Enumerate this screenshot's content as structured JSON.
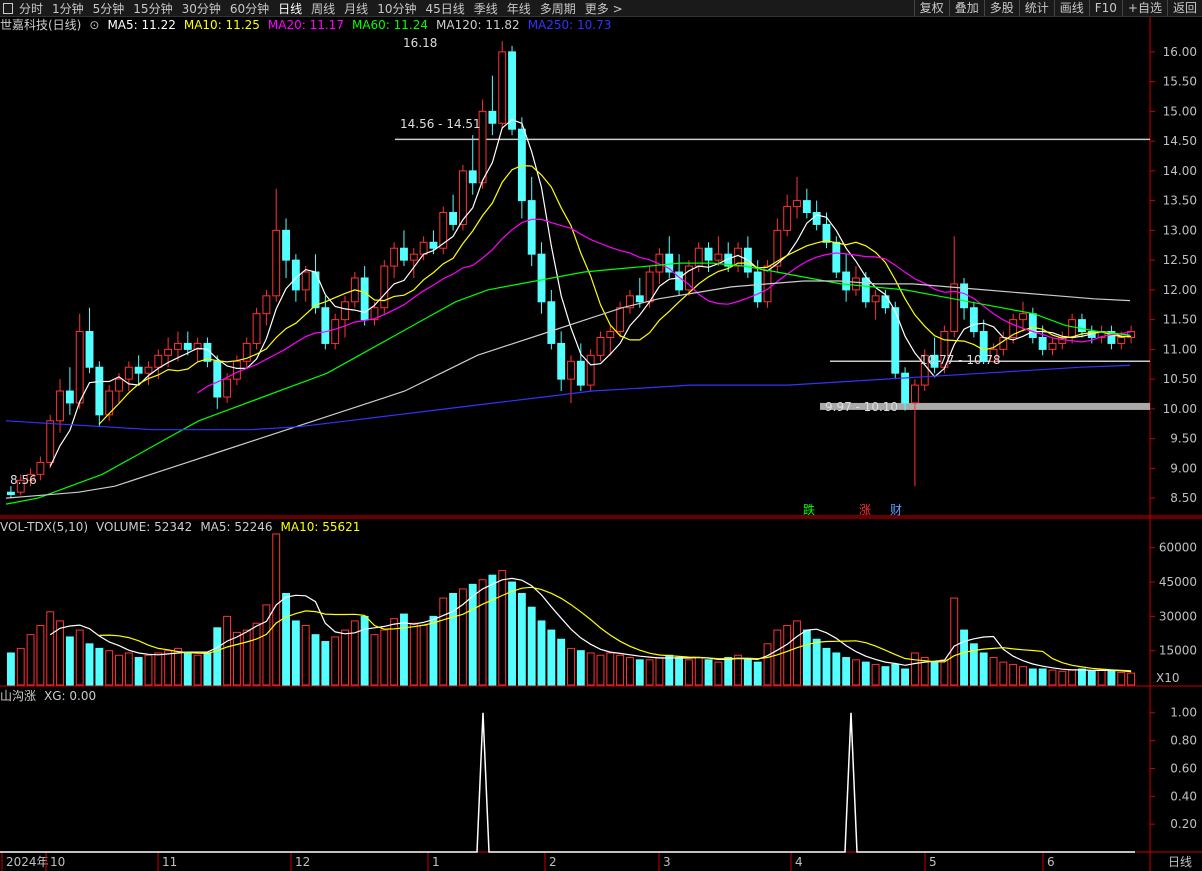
{
  "toolbar": {
    "menu_icon": "window-icon",
    "tabs": [
      "分时",
      "1分钟",
      "5分钟",
      "15分钟",
      "30分钟",
      "60分钟",
      "日线",
      "周线",
      "月线",
      "10分钟",
      "45日线",
      "季线",
      "年线",
      "多周期",
      "更多 >"
    ],
    "active_tab": "日线",
    "right_buttons": [
      "复权",
      "叠加",
      "多股",
      "统计",
      "画线",
      "F10",
      "+自选",
      "返回"
    ]
  },
  "main_legend": {
    "title": "世嘉科技(日线)",
    "items": [
      {
        "text": "MA5: 11.22",
        "color": "#ffffff"
      },
      {
        "text": "MA10: 11.25",
        "color": "#ffff00"
      },
      {
        "text": "MA20: 11.17",
        "color": "#ff00ff"
      },
      {
        "text": "MA60: 11.24",
        "color": "#00ff00"
      },
      {
        "text": "MA120: 11.82",
        "color": "#cccccc"
      },
      {
        "text": "MA250: 10.73",
        "color": "#3333ff"
      }
    ]
  },
  "vol_legend": {
    "items": [
      {
        "text": "VOL-TDX(5,10)",
        "color": "#cccccc"
      },
      {
        "text": "VOLUME: 52342",
        "color": "#cccccc"
      },
      {
        "text": "MA5: 52246",
        "color": "#cccccc"
      },
      {
        "text": "MA10: 55621",
        "color": "#ffff00"
      }
    ]
  },
  "ind_legend": {
    "items": [
      {
        "text": "山沟涨",
        "color": "#cccccc"
      },
      {
        "text": "XG: 0.00",
        "color": "#cccccc"
      }
    ]
  },
  "colors": {
    "up": "#ff3232",
    "down": "#54ffff",
    "axis": "#cc0000",
    "grid": "#3a0000"
  },
  "chart_data": [
    {
      "type": "candlestick",
      "title": "世嘉科技(日线)",
      "ylim": [
        8.2,
        16.3
      ],
      "y_ticks": [
        8.5,
        9.0,
        9.5,
        10.0,
        10.5,
        11.0,
        11.5,
        12.0,
        12.5,
        13.0,
        13.5,
        14.0,
        14.5,
        15.0,
        15.5,
        16.0
      ],
      "y_tick_labels": [
        "8.50",
        "9.00",
        "9.50",
        "10.00",
        "10.50",
        "11.00",
        "11.50",
        "12.00",
        "12.50",
        "13.00",
        "13.50",
        "14.00",
        "14.50",
        "15.00",
        "15.50",
        "16.00"
      ],
      "x_labels": [
        "2024年",
        "10",
        "11",
        "12",
        "1",
        "2",
        "3",
        "4",
        "5",
        "6"
      ],
      "ohlc": [
        [
          8.6,
          8.7,
          8.5,
          8.56
        ],
        [
          8.6,
          8.9,
          8.55,
          8.8
        ],
        [
          8.8,
          9.0,
          8.7,
          8.9
        ],
        [
          8.9,
          9.2,
          8.8,
          9.1
        ],
        [
          9.1,
          9.9,
          9.0,
          9.8
        ],
        [
          9.8,
          10.5,
          9.6,
          10.3
        ],
        [
          10.3,
          10.7,
          9.9,
          10.1
        ],
        [
          10.1,
          11.6,
          10.0,
          11.3
        ],
        [
          11.3,
          11.7,
          10.6,
          10.7
        ],
        [
          10.7,
          10.8,
          9.7,
          9.9
        ],
        [
          9.9,
          10.4,
          9.8,
          10.3
        ],
        [
          10.3,
          10.6,
          10.1,
          10.5
        ],
        [
          10.5,
          10.8,
          10.3,
          10.7
        ],
        [
          10.7,
          10.9,
          10.4,
          10.6
        ],
        [
          10.6,
          10.8,
          10.4,
          10.7
        ],
        [
          10.7,
          11.0,
          10.5,
          10.9
        ],
        [
          10.9,
          11.2,
          10.7,
          11.0
        ],
        [
          11.0,
          11.3,
          10.8,
          11.1
        ],
        [
          11.1,
          11.3,
          10.9,
          11.0
        ],
        [
          11.0,
          11.2,
          10.8,
          11.1
        ],
        [
          11.1,
          11.2,
          10.7,
          10.8
        ],
        [
          10.8,
          10.9,
          10.0,
          10.2
        ],
        [
          10.2,
          10.6,
          10.1,
          10.5
        ],
        [
          10.5,
          10.9,
          10.4,
          10.8
        ],
        [
          10.8,
          11.2,
          10.7,
          11.1
        ],
        [
          11.1,
          11.7,
          11.0,
          11.6
        ],
        [
          11.6,
          12.0,
          11.4,
          11.9
        ],
        [
          11.9,
          13.7,
          11.8,
          13.0
        ],
        [
          13.0,
          13.2,
          12.2,
          12.5
        ],
        [
          12.5,
          12.6,
          11.8,
          12.0
        ],
        [
          12.0,
          12.4,
          11.8,
          12.3
        ],
        [
          12.3,
          12.6,
          11.6,
          11.7
        ],
        [
          11.7,
          11.9,
          11.0,
          11.1
        ],
        [
          11.1,
          11.6,
          11.0,
          11.5
        ],
        [
          11.5,
          11.9,
          11.2,
          11.8
        ],
        [
          11.8,
          12.3,
          11.7,
          12.2
        ],
        [
          12.2,
          12.4,
          11.4,
          11.5
        ],
        [
          11.5,
          11.8,
          11.4,
          11.7
        ],
        [
          11.7,
          12.5,
          11.6,
          12.4
        ],
        [
          12.4,
          12.8,
          12.2,
          12.7
        ],
        [
          12.7,
          13.0,
          12.4,
          12.5
        ],
        [
          12.5,
          12.7,
          12.2,
          12.6
        ],
        [
          12.6,
          12.9,
          12.5,
          12.8
        ],
        [
          12.8,
          13.0,
          12.6,
          12.7
        ],
        [
          12.7,
          13.4,
          12.6,
          13.3
        ],
        [
          13.3,
          13.6,
          13.0,
          13.1
        ],
        [
          13.1,
          14.1,
          13.0,
          14.0
        ],
        [
          14.0,
          14.6,
          13.6,
          13.8
        ],
        [
          13.8,
          15.2,
          13.7,
          15.0
        ],
        [
          15.0,
          15.6,
          14.6,
          14.8
        ],
        [
          14.8,
          16.18,
          14.7,
          16.0
        ],
        [
          16.0,
          16.1,
          14.6,
          14.7
        ],
        [
          14.7,
          14.9,
          13.2,
          13.5
        ],
        [
          13.5,
          13.9,
          12.4,
          12.6
        ],
        [
          12.6,
          12.8,
          11.6,
          11.8
        ],
        [
          11.8,
          12.0,
          11.0,
          11.1
        ],
        [
          11.1,
          11.3,
          10.3,
          10.5
        ],
        [
          10.5,
          10.9,
          10.1,
          10.8
        ],
        [
          10.8,
          11.1,
          10.3,
          10.4
        ],
        [
          10.4,
          11.0,
          10.3,
          10.9
        ],
        [
          10.9,
          11.3,
          10.8,
          11.2
        ],
        [
          11.2,
          11.4,
          10.9,
          11.3
        ],
        [
          11.3,
          11.8,
          11.2,
          11.7
        ],
        [
          11.7,
          12.0,
          11.6,
          11.9
        ],
        [
          11.9,
          12.2,
          11.7,
          11.8
        ],
        [
          11.8,
          12.4,
          11.7,
          12.3
        ],
        [
          12.3,
          12.7,
          12.1,
          12.6
        ],
        [
          12.6,
          12.9,
          12.2,
          12.3
        ],
        [
          12.3,
          12.6,
          11.9,
          12.0
        ],
        [
          12.0,
          12.5,
          11.9,
          12.4
        ],
        [
          12.4,
          12.8,
          12.3,
          12.7
        ],
        [
          12.7,
          12.8,
          12.3,
          12.5
        ],
        [
          12.5,
          12.9,
          12.4,
          12.6
        ],
        [
          12.6,
          12.8,
          12.3,
          12.4
        ],
        [
          12.4,
          12.8,
          12.3,
          12.7
        ],
        [
          12.7,
          12.9,
          12.2,
          12.3
        ],
        [
          12.3,
          12.5,
          11.7,
          11.8
        ],
        [
          11.8,
          12.5,
          11.7,
          12.4
        ],
        [
          12.4,
          13.2,
          12.3,
          13.0
        ],
        [
          13.0,
          13.6,
          12.9,
          13.4
        ],
        [
          13.4,
          13.9,
          13.2,
          13.5
        ],
        [
          13.5,
          13.7,
          13.2,
          13.3
        ],
        [
          13.3,
          13.5,
          13.0,
          13.1
        ],
        [
          13.1,
          13.3,
          12.7,
          12.8
        ],
        [
          12.8,
          12.9,
          12.2,
          12.3
        ],
        [
          12.3,
          12.6,
          11.8,
          12.0
        ],
        [
          12.0,
          12.4,
          11.9,
          12.2
        ],
        [
          12.2,
          12.3,
          11.7,
          11.8
        ],
        [
          11.8,
          12.0,
          11.5,
          11.9
        ],
        [
          11.9,
          12.0,
          11.6,
          11.7
        ],
        [
          11.7,
          11.8,
          10.5,
          10.6
        ],
        [
          10.6,
          10.7,
          9.97,
          10.1
        ],
        [
          10.1,
          10.5,
          8.7,
          10.4
        ],
        [
          10.4,
          11.0,
          10.3,
          10.9
        ],
        [
          10.9,
          11.2,
          10.6,
          10.7
        ],
        [
          10.7,
          11.4,
          10.6,
          11.3
        ],
        [
          11.3,
          12.9,
          11.2,
          12.1
        ],
        [
          12.1,
          12.2,
          11.5,
          11.7
        ],
        [
          11.7,
          11.8,
          11.2,
          11.3
        ],
        [
          11.3,
          11.5,
          10.77,
          10.8
        ],
        [
          10.8,
          11.1,
          10.78,
          11.0
        ],
        [
          11.0,
          11.3,
          10.9,
          11.2
        ],
        [
          11.2,
          11.6,
          11.1,
          11.5
        ],
        [
          11.5,
          11.8,
          11.3,
          11.6
        ],
        [
          11.6,
          11.7,
          11.1,
          11.2
        ],
        [
          11.2,
          11.4,
          10.9,
          11.0
        ],
        [
          11.0,
          11.2,
          10.9,
          11.1
        ],
        [
          11.1,
          11.3,
          11.0,
          11.2
        ],
        [
          11.2,
          11.6,
          11.1,
          11.5
        ],
        [
          11.5,
          11.6,
          11.2,
          11.3
        ],
        [
          11.3,
          11.4,
          11.1,
          11.2
        ],
        [
          11.2,
          11.4,
          11.1,
          11.3
        ],
        [
          11.3,
          11.4,
          11.0,
          11.1
        ],
        [
          11.1,
          11.3,
          11.0,
          11.2
        ],
        [
          11.2,
          11.4,
          11.1,
          11.3
        ]
      ],
      "annotations": [
        "16.18",
        "14.56 - 14.51",
        "8.56",
        "10.77 - 10.78",
        "9.97 - 10.10"
      ],
      "markers": [
        {
          "text": "跌",
          "color": "#00ff00"
        },
        {
          "text": "涨",
          "color": "#ff3232"
        },
        {
          "text": "财",
          "color": "#5aa0ff"
        }
      ],
      "hlines": [
        {
          "y": 14.53,
          "color": "#cccccc"
        },
        {
          "y": 10.8,
          "color": "#cccccc"
        },
        {
          "y": 10.05,
          "color": "#aaaaaa",
          "band": true
        }
      ],
      "series": [
        {
          "name": "MA60",
          "color": "#00ff00",
          "values": [
            8.4,
            8.5,
            8.7,
            8.9,
            9.2,
            9.5,
            9.8,
            10.0,
            10.2,
            10.4,
            10.6,
            10.9,
            11.2,
            11.5,
            11.8,
            12.0,
            12.1,
            12.2,
            12.3,
            12.35,
            12.4,
            12.45,
            12.45,
            12.4,
            12.3,
            12.2,
            12.1,
            12.05,
            12.0,
            11.9,
            11.8,
            11.7,
            11.6,
            11.4,
            11.3,
            11.24
          ]
        },
        {
          "name": "MA120",
          "color": "#cccccc",
          "values": [
            8.5,
            8.55,
            8.6,
            8.7,
            8.9,
            9.1,
            9.3,
            9.5,
            9.7,
            9.9,
            10.1,
            10.3,
            10.6,
            10.9,
            11.1,
            11.3,
            11.5,
            11.7,
            11.85,
            11.95,
            12.05,
            12.1,
            12.15,
            12.15,
            12.1,
            12.1,
            12.05,
            12.0,
            11.95,
            11.9,
            11.85,
            11.82
          ]
        },
        {
          "name": "MA250",
          "color": "#3333ff",
          "values": [
            9.8,
            9.75,
            9.7,
            9.65,
            9.65,
            9.65,
            9.7,
            9.8,
            9.9,
            10.0,
            10.1,
            10.2,
            10.3,
            10.35,
            10.4,
            10.4,
            10.4,
            10.45,
            10.5,
            10.55,
            10.6,
            10.65,
            10.7,
            10.73
          ]
        }
      ]
    },
    {
      "type": "bar",
      "title": "VOL-TDX(5,10)",
      "ylim": [
        0,
        66000
      ],
      "y_ticks": [
        15000,
        30000,
        45000,
        60000
      ],
      "y_tick_labels": [
        "15000",
        "30000",
        "45000",
        "60000"
      ],
      "unit_label": "X10",
      "values": [
        14000,
        16000,
        22000,
        26000,
        32000,
        28000,
        21000,
        24000,
        18000,
        16000,
        15000,
        13000,
        14000,
        12000,
        13000,
        14000,
        15000,
        16000,
        14000,
        13000,
        14000,
        25000,
        30000,
        23000,
        24000,
        27000,
        35000,
        66000,
        40000,
        28000,
        26000,
        22000,
        19000,
        21000,
        24000,
        28000,
        30000,
        22000,
        24000,
        29000,
        31000,
        27000,
        26000,
        30000,
        38000,
        40000,
        42000,
        44000,
        46000,
        48000,
        50000,
        45000,
        40000,
        34000,
        28000,
        24000,
        20000,
        16000,
        15000,
        14000,
        13000,
        14000,
        13000,
        12000,
        11000,
        11000,
        12000,
        13000,
        12000,
        11000,
        12000,
        11000,
        10000,
        12000,
        13000,
        11000,
        10000,
        18000,
        24000,
        26000,
        28000,
        24000,
        20000,
        16000,
        14000,
        12000,
        11000,
        10000,
        9000,
        8000,
        9000,
        7000,
        14000,
        12000,
        10000,
        11000,
        38000,
        24000,
        18000,
        14000,
        12000,
        10000,
        9000,
        8000,
        7000,
        7000,
        6500,
        6000,
        6500,
        7000,
        6000,
        6500,
        6000,
        5500,
        5200
      ],
      "series": [
        {
          "name": "MA5",
          "color": "#ffffff"
        },
        {
          "name": "MA10",
          "color": "#ffff00"
        }
      ]
    },
    {
      "type": "line",
      "title": "山沟涨",
      "ylim": [
        0,
        1.07
      ],
      "y_ticks": [
        0.2,
        0.4,
        0.6,
        0.8,
        1.0
      ],
      "y_tick_labels": [
        "0.20",
        "0.40",
        "0.60",
        "0.80",
        "1.00"
      ],
      "spikes": [
        0.42,
        0.74
      ],
      "values_note_none": true
    }
  ],
  "bottom_axis": {
    "right_label": "日线"
  }
}
